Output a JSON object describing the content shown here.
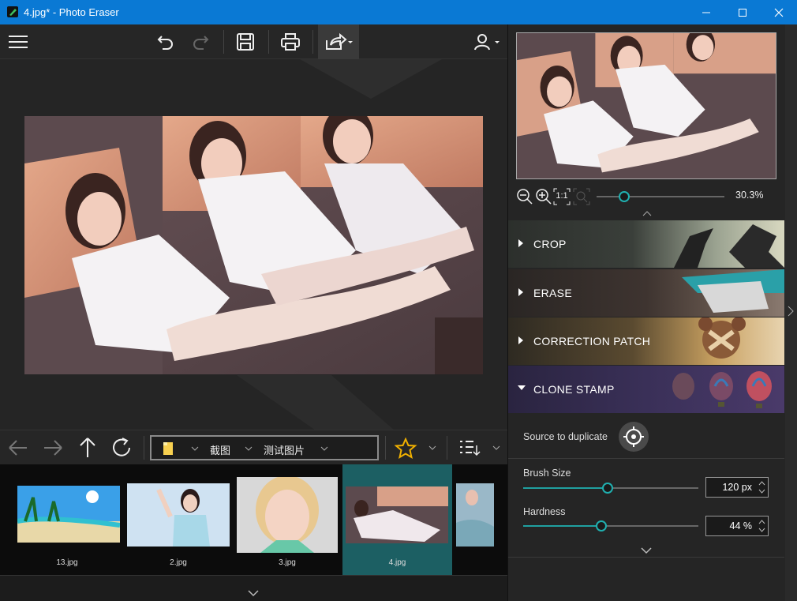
{
  "window": {
    "title": "4.jpg* - Photo Eraser"
  },
  "navigator": {
    "zoom_label": "30.3%",
    "fit_label": "1:1"
  },
  "path": {
    "segments": [
      "截图",
      "测试图片"
    ]
  },
  "thumbnails": [
    {
      "label": "13.jpg",
      "selected": false
    },
    {
      "label": "2.jpg",
      "selected": false
    },
    {
      "label": "3.jpg",
      "selected": false
    },
    {
      "label": "4.jpg",
      "selected": true
    },
    {
      "label": "",
      "selected": false
    }
  ],
  "tools": {
    "crop": "CROP",
    "erase": "ERASE",
    "correction_patch": "CORRECTION PATCH",
    "clone_stamp": "CLONE STAMP"
  },
  "clone": {
    "source_label": "Source to duplicate",
    "brush_size_label": "Brush Size",
    "brush_size_value": "120 px",
    "brush_size_fraction": 0.48,
    "hardness_label": "Hardness",
    "hardness_value": "44 %",
    "hardness_fraction": 0.44
  },
  "colors": {
    "titlebar": "#0a79d4",
    "accent": "#20a0a0",
    "selected_thumb": "#1c5f63",
    "star": "#f0b000"
  }
}
